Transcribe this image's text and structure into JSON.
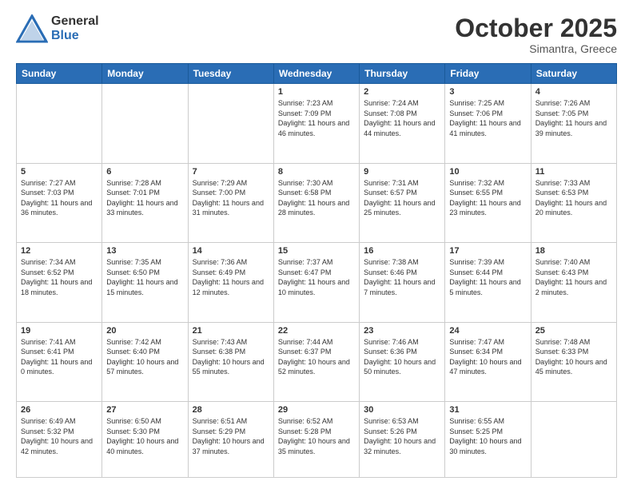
{
  "header": {
    "logo_line1": "General",
    "logo_line2": "Blue",
    "month": "October 2025",
    "location": "Simantra, Greece"
  },
  "weekdays": [
    "Sunday",
    "Monday",
    "Tuesday",
    "Wednesday",
    "Thursday",
    "Friday",
    "Saturday"
  ],
  "weeks": [
    [
      {
        "day": "",
        "info": ""
      },
      {
        "day": "",
        "info": ""
      },
      {
        "day": "",
        "info": ""
      },
      {
        "day": "1",
        "info": "Sunrise: 7:23 AM\nSunset: 7:09 PM\nDaylight: 11 hours\nand 46 minutes."
      },
      {
        "day": "2",
        "info": "Sunrise: 7:24 AM\nSunset: 7:08 PM\nDaylight: 11 hours\nand 44 minutes."
      },
      {
        "day": "3",
        "info": "Sunrise: 7:25 AM\nSunset: 7:06 PM\nDaylight: 11 hours\nand 41 minutes."
      },
      {
        "day": "4",
        "info": "Sunrise: 7:26 AM\nSunset: 7:05 PM\nDaylight: 11 hours\nand 39 minutes."
      }
    ],
    [
      {
        "day": "5",
        "info": "Sunrise: 7:27 AM\nSunset: 7:03 PM\nDaylight: 11 hours\nand 36 minutes."
      },
      {
        "day": "6",
        "info": "Sunrise: 7:28 AM\nSunset: 7:01 PM\nDaylight: 11 hours\nand 33 minutes."
      },
      {
        "day": "7",
        "info": "Sunrise: 7:29 AM\nSunset: 7:00 PM\nDaylight: 11 hours\nand 31 minutes."
      },
      {
        "day": "8",
        "info": "Sunrise: 7:30 AM\nSunset: 6:58 PM\nDaylight: 11 hours\nand 28 minutes."
      },
      {
        "day": "9",
        "info": "Sunrise: 7:31 AM\nSunset: 6:57 PM\nDaylight: 11 hours\nand 25 minutes."
      },
      {
        "day": "10",
        "info": "Sunrise: 7:32 AM\nSunset: 6:55 PM\nDaylight: 11 hours\nand 23 minutes."
      },
      {
        "day": "11",
        "info": "Sunrise: 7:33 AM\nSunset: 6:53 PM\nDaylight: 11 hours\nand 20 minutes."
      }
    ],
    [
      {
        "day": "12",
        "info": "Sunrise: 7:34 AM\nSunset: 6:52 PM\nDaylight: 11 hours\nand 18 minutes."
      },
      {
        "day": "13",
        "info": "Sunrise: 7:35 AM\nSunset: 6:50 PM\nDaylight: 11 hours\nand 15 minutes."
      },
      {
        "day": "14",
        "info": "Sunrise: 7:36 AM\nSunset: 6:49 PM\nDaylight: 11 hours\nand 12 minutes."
      },
      {
        "day": "15",
        "info": "Sunrise: 7:37 AM\nSunset: 6:47 PM\nDaylight: 11 hours\nand 10 minutes."
      },
      {
        "day": "16",
        "info": "Sunrise: 7:38 AM\nSunset: 6:46 PM\nDaylight: 11 hours\nand 7 minutes."
      },
      {
        "day": "17",
        "info": "Sunrise: 7:39 AM\nSunset: 6:44 PM\nDaylight: 11 hours\nand 5 minutes."
      },
      {
        "day": "18",
        "info": "Sunrise: 7:40 AM\nSunset: 6:43 PM\nDaylight: 11 hours\nand 2 minutes."
      }
    ],
    [
      {
        "day": "19",
        "info": "Sunrise: 7:41 AM\nSunset: 6:41 PM\nDaylight: 11 hours\nand 0 minutes."
      },
      {
        "day": "20",
        "info": "Sunrise: 7:42 AM\nSunset: 6:40 PM\nDaylight: 10 hours\nand 57 minutes."
      },
      {
        "day": "21",
        "info": "Sunrise: 7:43 AM\nSunset: 6:38 PM\nDaylight: 10 hours\nand 55 minutes."
      },
      {
        "day": "22",
        "info": "Sunrise: 7:44 AM\nSunset: 6:37 PM\nDaylight: 10 hours\nand 52 minutes."
      },
      {
        "day": "23",
        "info": "Sunrise: 7:46 AM\nSunset: 6:36 PM\nDaylight: 10 hours\nand 50 minutes."
      },
      {
        "day": "24",
        "info": "Sunrise: 7:47 AM\nSunset: 6:34 PM\nDaylight: 10 hours\nand 47 minutes."
      },
      {
        "day": "25",
        "info": "Sunrise: 7:48 AM\nSunset: 6:33 PM\nDaylight: 10 hours\nand 45 minutes."
      }
    ],
    [
      {
        "day": "26",
        "info": "Sunrise: 6:49 AM\nSunset: 5:32 PM\nDaylight: 10 hours\nand 42 minutes."
      },
      {
        "day": "27",
        "info": "Sunrise: 6:50 AM\nSunset: 5:30 PM\nDaylight: 10 hours\nand 40 minutes."
      },
      {
        "day": "28",
        "info": "Sunrise: 6:51 AM\nSunset: 5:29 PM\nDaylight: 10 hours\nand 37 minutes."
      },
      {
        "day": "29",
        "info": "Sunrise: 6:52 AM\nSunset: 5:28 PM\nDaylight: 10 hours\nand 35 minutes."
      },
      {
        "day": "30",
        "info": "Sunrise: 6:53 AM\nSunset: 5:26 PM\nDaylight: 10 hours\nand 32 minutes."
      },
      {
        "day": "31",
        "info": "Sunrise: 6:55 AM\nSunset: 5:25 PM\nDaylight: 10 hours\nand 30 minutes."
      },
      {
        "day": "",
        "info": ""
      }
    ]
  ]
}
